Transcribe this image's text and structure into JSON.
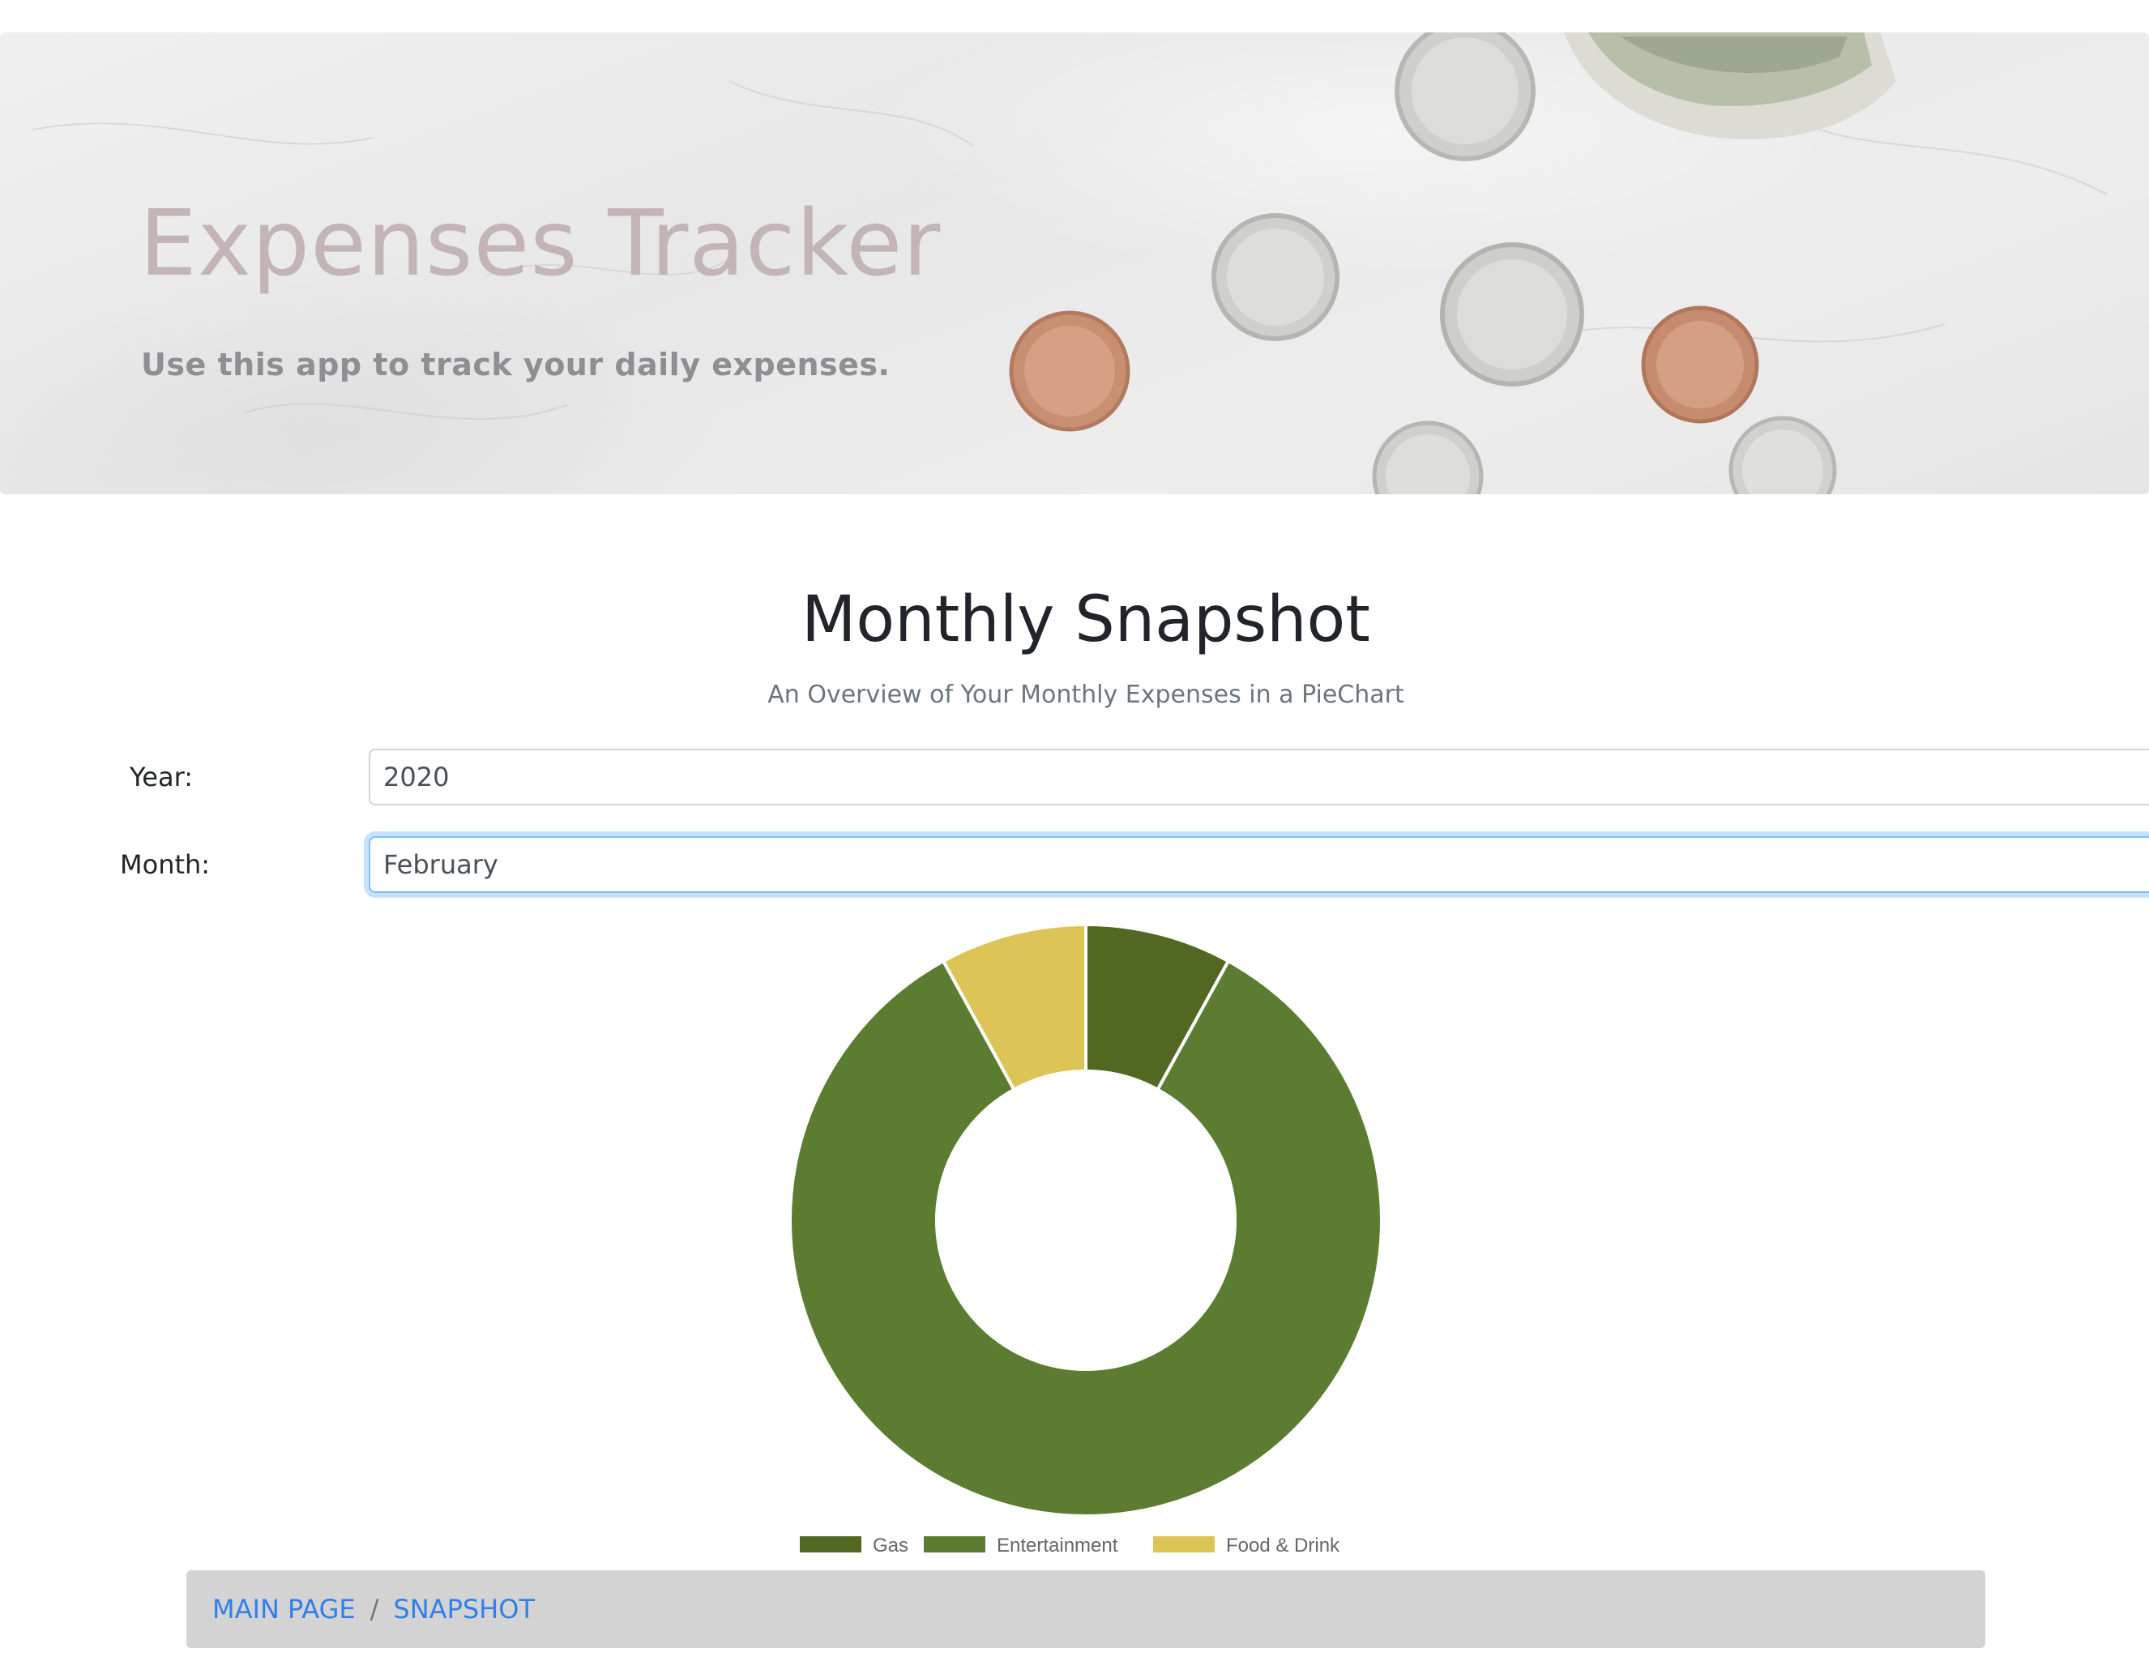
{
  "header": {
    "title": "Expenses Tracker",
    "subtitle": "Use this app to track your daily expenses."
  },
  "main": {
    "title": "Monthly Snapshot",
    "subtitle": "An Overview of Your Monthly Expenses in a PieChart"
  },
  "form": {
    "year_label": "Year:",
    "year_value": "2020",
    "month_label": "Month:",
    "month_value": "February"
  },
  "chart_data": {
    "type": "pie",
    "variant": "doughnut",
    "categories": [
      "Gas",
      "Entertainment",
      "Food & Drink"
    ],
    "values": [
      8,
      84,
      8
    ],
    "colors": [
      "#526722",
      "#5c7c31",
      "#dcc556"
    ],
    "legend_position": "bottom"
  },
  "breadcrumb": {
    "items": [
      "MAIN PAGE",
      "SNAPSHOT"
    ],
    "separator": "/"
  },
  "colors": {
    "link": "#2f80ed",
    "breadcrumb_bg": "#d3d3d3",
    "focus_ring": "#80bdff"
  }
}
